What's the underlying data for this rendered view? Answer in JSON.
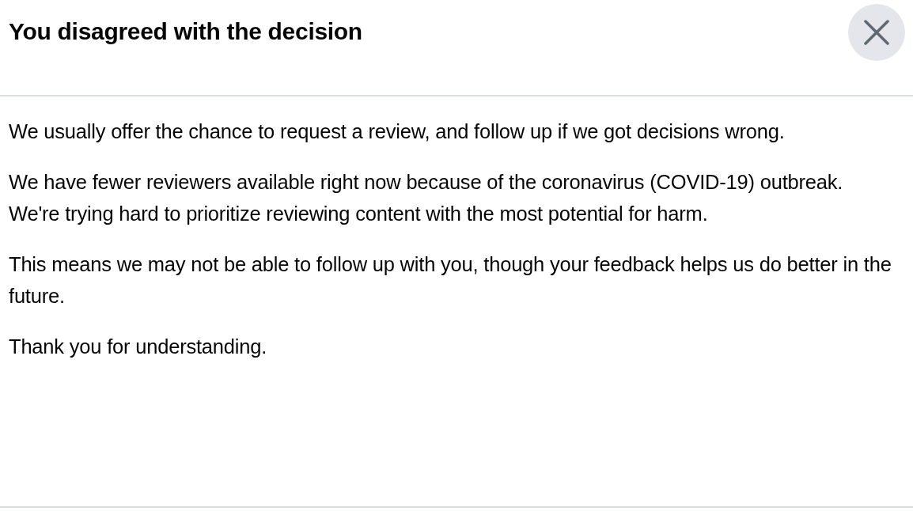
{
  "dialog": {
    "title": "You disagreed with the decision",
    "paragraphs": [
      "We usually offer the chance to request a review, and follow up if we got decisions wrong.",
      "We have fewer reviewers available right now because of the coronavirus (COVID-19) outbreak. We're trying hard to prioritize reviewing content with the most potential for harm.",
      "This means we may not be able to follow up with you, though your feedback helps us do better in the future.",
      "Thank you for understanding."
    ]
  }
}
